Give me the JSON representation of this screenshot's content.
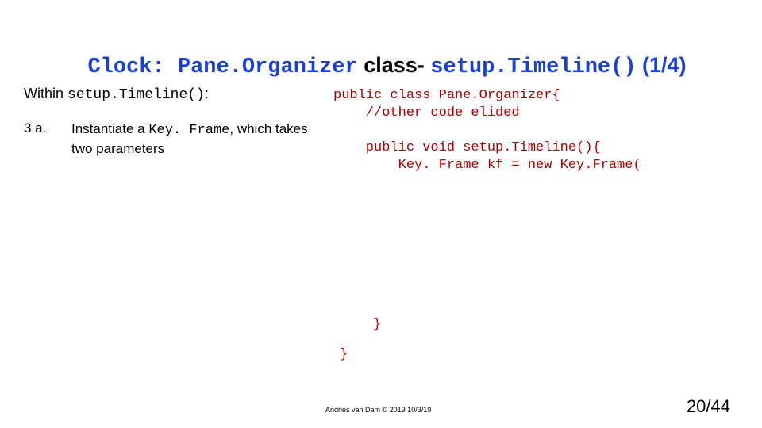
{
  "title": {
    "part1": "Clock: Pane.Organizer",
    "part2": " class- ",
    "part3": "setup.Timeline()",
    "part4": " (1/4)"
  },
  "intro": {
    "prefix": "Within ",
    "code": "setup.Timeline()",
    "suffix": ":"
  },
  "step": {
    "num": "3 a.",
    "text_before": "Instantiate a  ",
    "code": "Key. Frame",
    "text_after": ", which takes two parameters"
  },
  "code": {
    "line1": "public class Pane.Organizer{",
    "line2": "    //other code elided",
    "line3": "",
    "line4": "    public void setup.Timeline(){",
    "line5": "        Key. Frame kf = new Key.Frame(",
    "brace1": "}",
    "brace2": "}"
  },
  "footer": {
    "credit": "Andries van Dam © 2019 10/3/19",
    "page": "20/44"
  }
}
